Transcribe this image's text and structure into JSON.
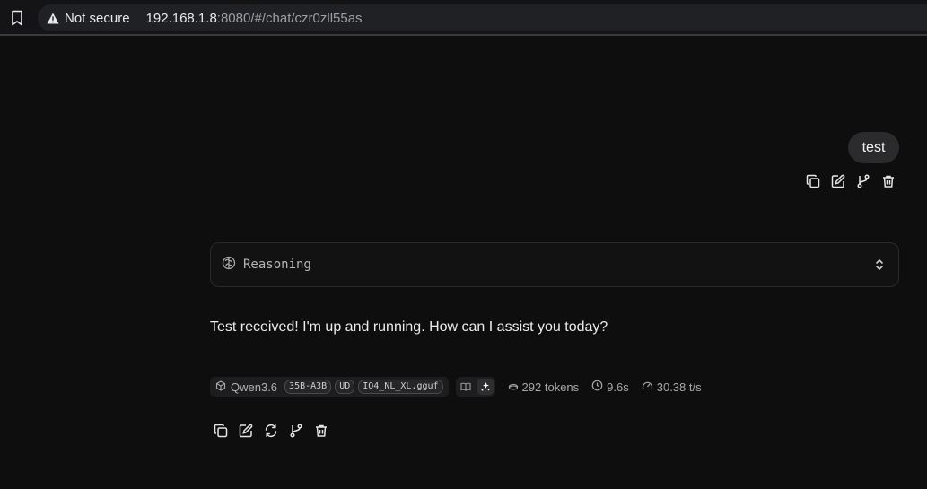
{
  "browser": {
    "security_label": "Not secure",
    "url_host": "192.168.1.8",
    "url_path": ":8080/#/chat/czr0zll55as"
  },
  "user_message": {
    "text": "test",
    "actions": [
      "copy-icon",
      "edit-icon",
      "branch-icon",
      "trash-icon"
    ]
  },
  "assistant": {
    "reasoning_label": "Reasoning",
    "reply": "Test received! I'm up and running. How can I assist you today?",
    "model": {
      "name": "Qwen3.6",
      "tags": [
        "35B-A3B",
        "UD",
        "IQ4_NL_XL.gguf"
      ]
    },
    "stats": {
      "tokens": "292 tokens",
      "time": "9.6s",
      "speed": "30.38 t/s"
    },
    "actions": [
      "copy-icon",
      "edit-icon",
      "regenerate-icon",
      "branch-icon",
      "trash-icon"
    ]
  }
}
